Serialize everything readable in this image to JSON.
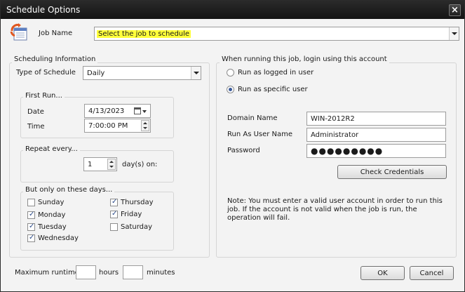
{
  "window": {
    "title": "Schedule Options",
    "close_glyph": "×"
  },
  "job": {
    "label": "Job Name",
    "value": "Select the job to schedule",
    "highlight_color": "#ffff3a"
  },
  "scheduling": {
    "group_title": "Scheduling Information",
    "type_label": "Type of Schedule",
    "type_value": "Daily",
    "first_run": {
      "title": "First Run...",
      "date_label": "Date",
      "date_value": "4/13/2023",
      "time_label": "Time",
      "time_value": "7:00:00 PM"
    },
    "repeat": {
      "title": "Repeat every...",
      "value": "1",
      "unit": "day(s) on:"
    },
    "days": {
      "title": "But only on these days...",
      "items": [
        {
          "label": "Sunday",
          "checked": false
        },
        {
          "label": "Monday",
          "checked": true
        },
        {
          "label": "Tuesday",
          "checked": true
        },
        {
          "label": "Wednesday",
          "checked": true
        },
        {
          "label": "Thursday",
          "checked": true
        },
        {
          "label": "Friday",
          "checked": true
        },
        {
          "label": "Saturday",
          "checked": false
        }
      ]
    }
  },
  "login": {
    "group_title": "When running this job, login using this account",
    "options": [
      {
        "label": "Run as logged in user",
        "selected": false
      },
      {
        "label": "Run as specific user",
        "selected": true
      }
    ],
    "domain_label": "Domain Name",
    "domain_value": "WIN-2012R2",
    "user_label": "Run As User Name",
    "user_value": "Administrator",
    "password_label": "Password",
    "password_value": "●●●●●●●●●",
    "check_button": "Check Credentials",
    "note": "Note: You must enter a valid user account in order to run this job. If the account is not valid when the job is run, the operation will fail."
  },
  "runtime": {
    "label": "Maximum runtime:",
    "hours_label": "hours",
    "minutes_label": "minutes",
    "hours_value": "",
    "minutes_value": ""
  },
  "buttons": {
    "ok": "OK",
    "cancel": "Cancel"
  }
}
